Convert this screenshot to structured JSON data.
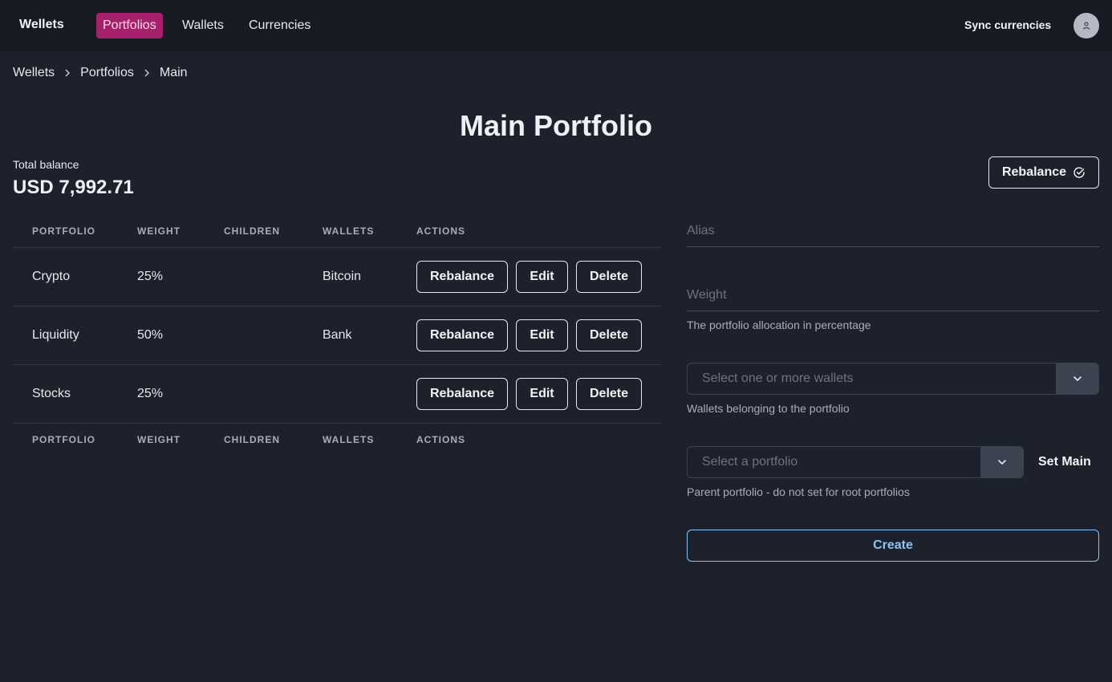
{
  "nav": {
    "brand": "Wellets",
    "links": [
      {
        "label": "Portfolios",
        "active": true
      },
      {
        "label": "Wallets",
        "active": false
      },
      {
        "label": "Currencies",
        "active": false
      }
    ],
    "sync_label": "Sync currencies",
    "avatar_icon": "user-icon"
  },
  "breadcrumb": [
    "Wellets",
    "Portfolios",
    "Main"
  ],
  "page": {
    "title": "Main Portfolio",
    "total_label": "Total balance",
    "total_value": "USD 7,992.71",
    "rebalance_label": "Rebalance"
  },
  "table": {
    "headers": [
      "PORTFOLIO",
      "WEIGHT",
      "CHILDREN",
      "WALLETS",
      "ACTIONS"
    ],
    "rows": [
      {
        "portfolio": "Crypto",
        "weight": "25%",
        "children": "",
        "wallets": "Bitcoin"
      },
      {
        "portfolio": "Liquidity",
        "weight": "50%",
        "children": "",
        "wallets": "Bank"
      },
      {
        "portfolio": "Stocks",
        "weight": "25%",
        "children": "",
        "wallets": ""
      }
    ],
    "actions": {
      "rebalance": "Rebalance",
      "edit": "Edit",
      "delete": "Delete"
    }
  },
  "form": {
    "alias_placeholder": "Alias",
    "weight_placeholder": "Weight",
    "weight_helper": "The portfolio allocation in percentage",
    "wallets_placeholder": "Select one or more wallets",
    "wallets_helper": "Wallets belonging to the portfolio",
    "parent_placeholder": "Select a portfolio",
    "set_main_label": "Set Main",
    "parent_helper": "Parent portfolio - do not set for root portfolios",
    "create_label": "Create"
  },
  "colors": {
    "background": "#1d212c",
    "navbar": "#181b23",
    "active_nav": "#a5216b",
    "create_accent": "#8cc3f0"
  }
}
